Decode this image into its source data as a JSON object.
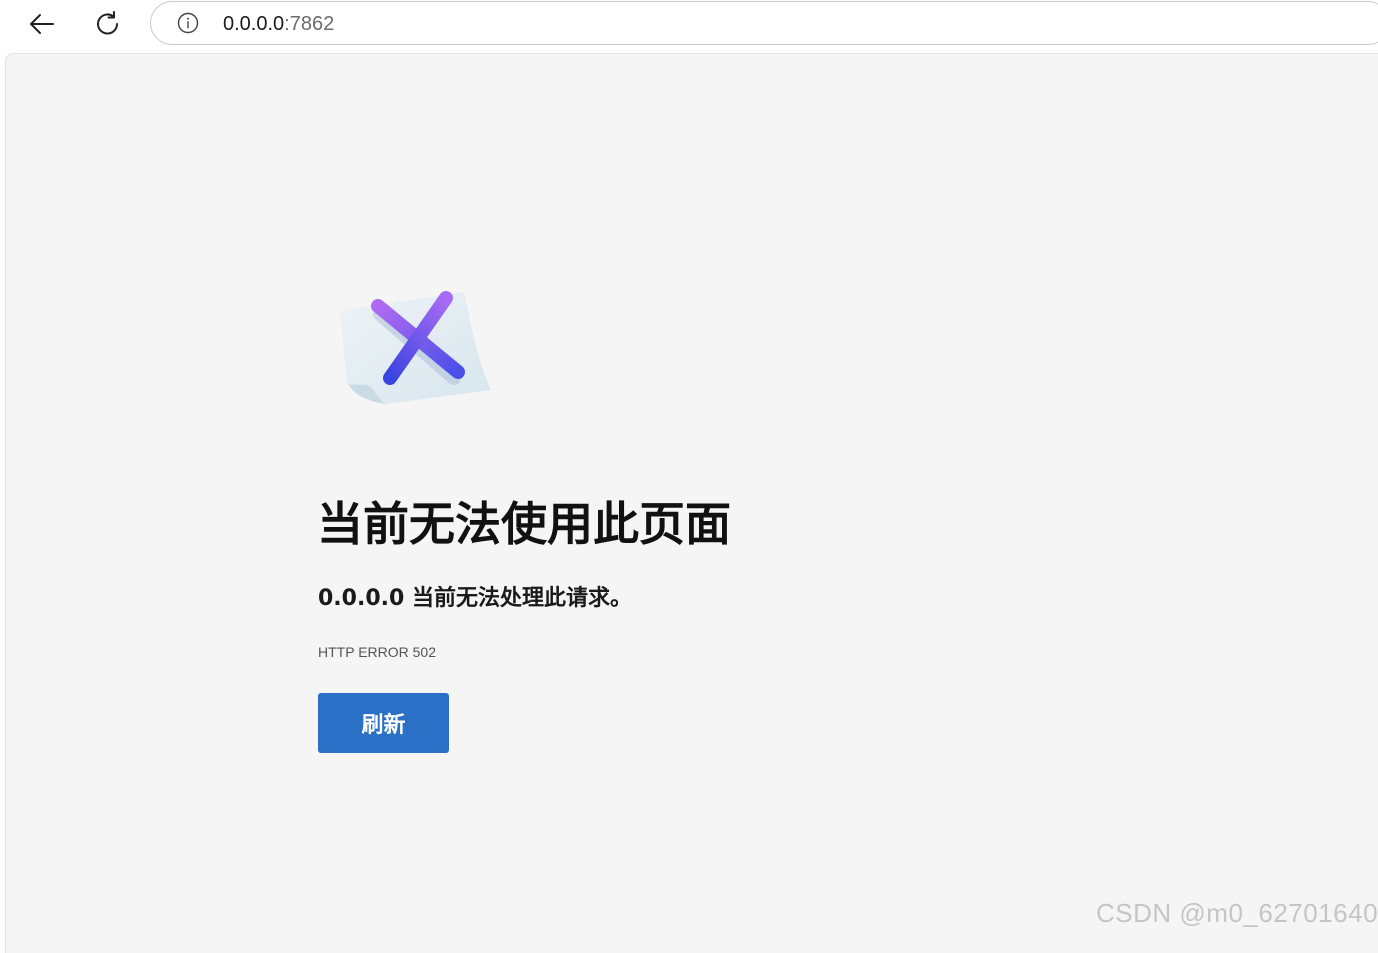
{
  "browser": {
    "url_host": "0.0.0.0",
    "url_port": ":7862"
  },
  "error_page": {
    "title": "当前无法使用此页面",
    "subtitle": "0.0.0.0 当前无法处理此请求。",
    "code": "HTTP ERROR 502",
    "refresh_label": "刷新"
  },
  "watermark": {
    "text": "CSDN @m0_62701640"
  },
  "colors": {
    "button_bg": "#2a70c6",
    "page_bg": "#f5f5f5",
    "x_gradient_start": "#9a5cf0",
    "x_gradient_end": "#3f4be6"
  }
}
